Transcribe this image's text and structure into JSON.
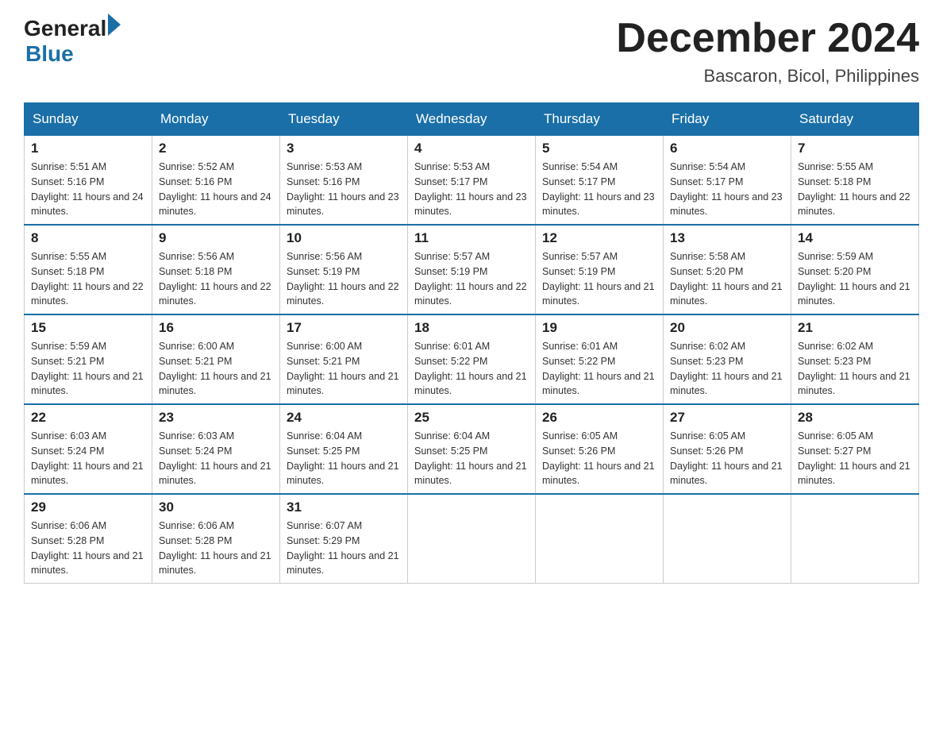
{
  "header": {
    "logo_general": "General",
    "logo_blue": "Blue",
    "month_year": "December 2024",
    "location": "Bascaron, Bicol, Philippines"
  },
  "weekdays": [
    "Sunday",
    "Monday",
    "Tuesday",
    "Wednesday",
    "Thursday",
    "Friday",
    "Saturday"
  ],
  "weeks": [
    [
      {
        "day": "1",
        "sunrise": "5:51 AM",
        "sunset": "5:16 PM",
        "daylight": "11 hours and 24 minutes."
      },
      {
        "day": "2",
        "sunrise": "5:52 AM",
        "sunset": "5:16 PM",
        "daylight": "11 hours and 24 minutes."
      },
      {
        "day": "3",
        "sunrise": "5:53 AM",
        "sunset": "5:16 PM",
        "daylight": "11 hours and 23 minutes."
      },
      {
        "day": "4",
        "sunrise": "5:53 AM",
        "sunset": "5:17 PM",
        "daylight": "11 hours and 23 minutes."
      },
      {
        "day": "5",
        "sunrise": "5:54 AM",
        "sunset": "5:17 PM",
        "daylight": "11 hours and 23 minutes."
      },
      {
        "day": "6",
        "sunrise": "5:54 AM",
        "sunset": "5:17 PM",
        "daylight": "11 hours and 23 minutes."
      },
      {
        "day": "7",
        "sunrise": "5:55 AM",
        "sunset": "5:18 PM",
        "daylight": "11 hours and 22 minutes."
      }
    ],
    [
      {
        "day": "8",
        "sunrise": "5:55 AM",
        "sunset": "5:18 PM",
        "daylight": "11 hours and 22 minutes."
      },
      {
        "day": "9",
        "sunrise": "5:56 AM",
        "sunset": "5:18 PM",
        "daylight": "11 hours and 22 minutes."
      },
      {
        "day": "10",
        "sunrise": "5:56 AM",
        "sunset": "5:19 PM",
        "daylight": "11 hours and 22 minutes."
      },
      {
        "day": "11",
        "sunrise": "5:57 AM",
        "sunset": "5:19 PM",
        "daylight": "11 hours and 22 minutes."
      },
      {
        "day": "12",
        "sunrise": "5:57 AM",
        "sunset": "5:19 PM",
        "daylight": "11 hours and 21 minutes."
      },
      {
        "day": "13",
        "sunrise": "5:58 AM",
        "sunset": "5:20 PM",
        "daylight": "11 hours and 21 minutes."
      },
      {
        "day": "14",
        "sunrise": "5:59 AM",
        "sunset": "5:20 PM",
        "daylight": "11 hours and 21 minutes."
      }
    ],
    [
      {
        "day": "15",
        "sunrise": "5:59 AM",
        "sunset": "5:21 PM",
        "daylight": "11 hours and 21 minutes."
      },
      {
        "day": "16",
        "sunrise": "6:00 AM",
        "sunset": "5:21 PM",
        "daylight": "11 hours and 21 minutes."
      },
      {
        "day": "17",
        "sunrise": "6:00 AM",
        "sunset": "5:21 PM",
        "daylight": "11 hours and 21 minutes."
      },
      {
        "day": "18",
        "sunrise": "6:01 AM",
        "sunset": "5:22 PM",
        "daylight": "11 hours and 21 minutes."
      },
      {
        "day": "19",
        "sunrise": "6:01 AM",
        "sunset": "5:22 PM",
        "daylight": "11 hours and 21 minutes."
      },
      {
        "day": "20",
        "sunrise": "6:02 AM",
        "sunset": "5:23 PM",
        "daylight": "11 hours and 21 minutes."
      },
      {
        "day": "21",
        "sunrise": "6:02 AM",
        "sunset": "5:23 PM",
        "daylight": "11 hours and 21 minutes."
      }
    ],
    [
      {
        "day": "22",
        "sunrise": "6:03 AM",
        "sunset": "5:24 PM",
        "daylight": "11 hours and 21 minutes."
      },
      {
        "day": "23",
        "sunrise": "6:03 AM",
        "sunset": "5:24 PM",
        "daylight": "11 hours and 21 minutes."
      },
      {
        "day": "24",
        "sunrise": "6:04 AM",
        "sunset": "5:25 PM",
        "daylight": "11 hours and 21 minutes."
      },
      {
        "day": "25",
        "sunrise": "6:04 AM",
        "sunset": "5:25 PM",
        "daylight": "11 hours and 21 minutes."
      },
      {
        "day": "26",
        "sunrise": "6:05 AM",
        "sunset": "5:26 PM",
        "daylight": "11 hours and 21 minutes."
      },
      {
        "day": "27",
        "sunrise": "6:05 AM",
        "sunset": "5:26 PM",
        "daylight": "11 hours and 21 minutes."
      },
      {
        "day": "28",
        "sunrise": "6:05 AM",
        "sunset": "5:27 PM",
        "daylight": "11 hours and 21 minutes."
      }
    ],
    [
      {
        "day": "29",
        "sunrise": "6:06 AM",
        "sunset": "5:28 PM",
        "daylight": "11 hours and 21 minutes."
      },
      {
        "day": "30",
        "sunrise": "6:06 AM",
        "sunset": "5:28 PM",
        "daylight": "11 hours and 21 minutes."
      },
      {
        "day": "31",
        "sunrise": "6:07 AM",
        "sunset": "5:29 PM",
        "daylight": "11 hours and 21 minutes."
      },
      null,
      null,
      null,
      null
    ]
  ],
  "labels": {
    "sunrise": "Sunrise:",
    "sunset": "Sunset:",
    "daylight": "Daylight:"
  }
}
